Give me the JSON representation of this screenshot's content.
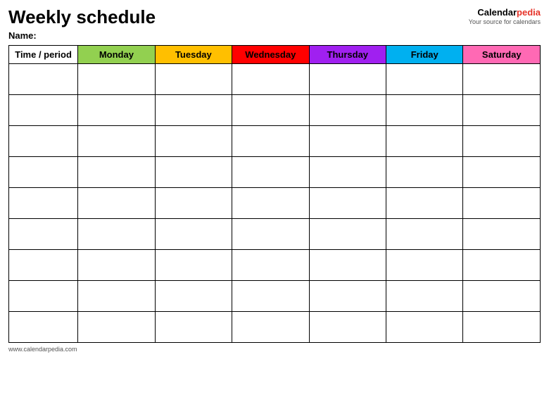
{
  "header": {
    "title": "Weekly schedule",
    "brand": {
      "calendar": "Calendar",
      "pedia": "pedia",
      "tagline": "Your source for calendars"
    },
    "name_label": "Name:"
  },
  "table": {
    "columns": [
      {
        "key": "time",
        "label": "Time / period",
        "class": "col-time"
      },
      {
        "key": "monday",
        "label": "Monday",
        "class": "col-monday"
      },
      {
        "key": "tuesday",
        "label": "Tuesday",
        "class": "col-tuesday"
      },
      {
        "key": "wednesday",
        "label": "Wednesday",
        "class": "col-wednesday"
      },
      {
        "key": "thursday",
        "label": "Thursday",
        "class": "col-thursday"
      },
      {
        "key": "friday",
        "label": "Friday",
        "class": "col-friday"
      },
      {
        "key": "saturday",
        "label": "Saturday",
        "class": "col-saturday"
      }
    ],
    "row_count": 9
  },
  "footer": {
    "url": "www.calendarpedia.com"
  }
}
